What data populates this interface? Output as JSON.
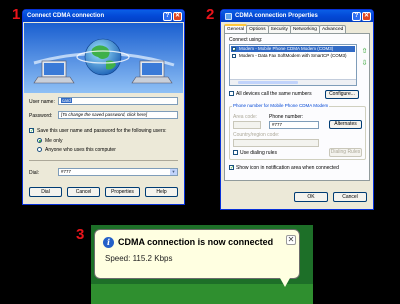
{
  "steps": [
    "1",
    "2",
    "3"
  ],
  "connect_dialog": {
    "title": "Connect CDMA connection",
    "title_buttons": [
      "?",
      "✕"
    ],
    "user_name_label": "User name:",
    "user_name_value": "card",
    "password_label": "Password:",
    "password_value": "[To change the saved password, click here]",
    "save_checkbox_label": "Save this user name and password for the following users:",
    "save_checked": true,
    "radio_me_only": "Me only",
    "radio_anyone": "Anyone who uses this computer",
    "selected_radio": "Me only",
    "dial_label": "Dial:",
    "dial_value": "#777",
    "buttons": {
      "dial": "Dial",
      "cancel": "Cancel",
      "properties": "Properties",
      "help": "Help"
    }
  },
  "properties_dialog": {
    "title": "CDMA connection Properties",
    "title_buttons": [
      "?",
      "✕"
    ],
    "tabs": [
      "General",
      "Options",
      "Security",
      "Networking",
      "Advanced"
    ],
    "active_tab": "General",
    "connect_using_label": "Connect using:",
    "devices": [
      {
        "label": "Modem - Mobile Phone CDMA Modem (COM3)",
        "checked": true,
        "selected": true
      },
      {
        "label": "Modem - Data Fax SoftModem with SmartCP (COM3)",
        "checked": false,
        "selected": false
      }
    ],
    "all_devices_label": "All devices call the same numbers",
    "configure_button": "Configure...",
    "phone_group_title": "Phone number for Mobile Phone CDMA Modem",
    "area_code_label": "Area code:",
    "phone_number_label": "Phone number:",
    "phone_number_value": "#777",
    "alternates_button": "Alternates",
    "country_label": "Country/region code:",
    "dialing_rules_label": "Use dialing rules",
    "dialing_rules_button": "Dialing Rules",
    "show_icon_label": "Show icon in notification area when connected",
    "show_icon_checked": true,
    "ok_button": "OK",
    "cancel_button": "Cancel"
  },
  "balloon": {
    "title": "CDMA connection is now connected",
    "body": "Speed: 115.2 Kbps",
    "close_symbol": "✕",
    "icon_glyph": "i"
  }
}
